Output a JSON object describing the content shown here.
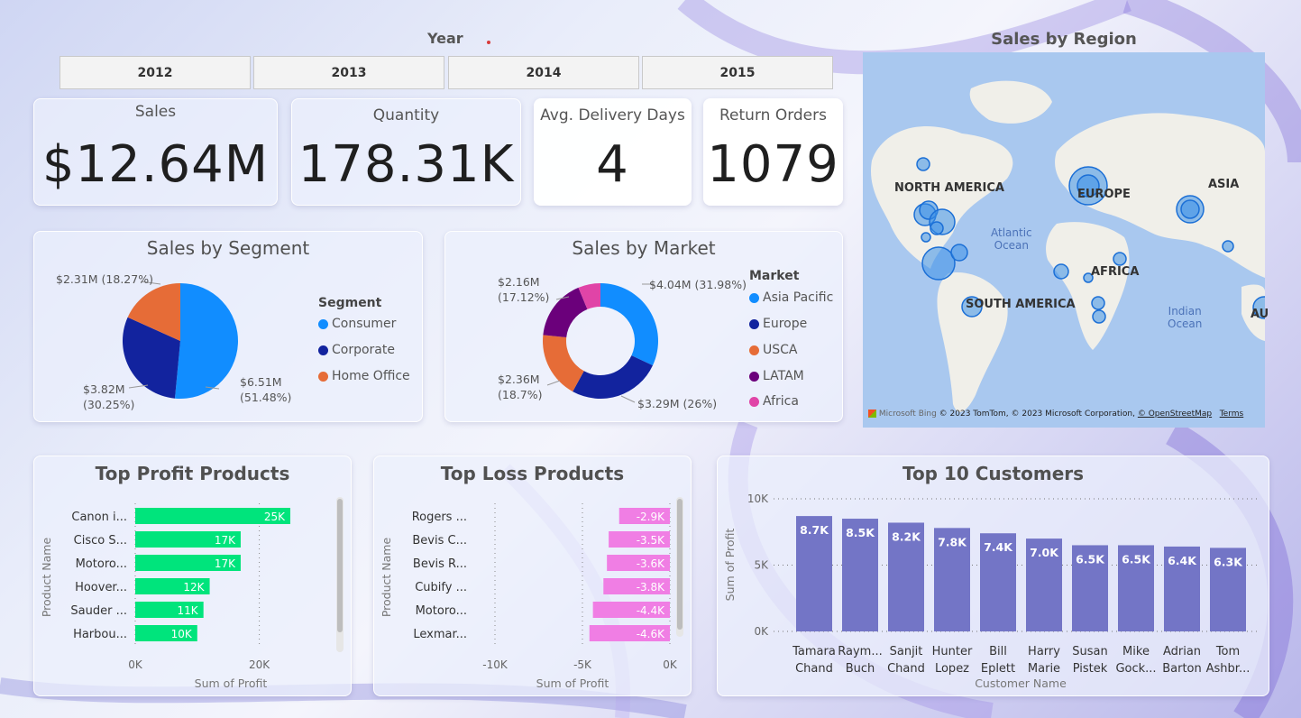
{
  "year_filter": {
    "title": "Year",
    "options": [
      "2012",
      "2013",
      "2014",
      "2015"
    ]
  },
  "kpis": {
    "sales": {
      "label": "Sales",
      "value": "$12.64M"
    },
    "quantity": {
      "label": "Quantity",
      "value": "178.31K"
    },
    "delivery": {
      "label": "Avg. Delivery Days",
      "value": "4"
    },
    "returns": {
      "label": "Return Orders",
      "value": "1079"
    }
  },
  "segment": {
    "title": "Sales by Segment",
    "legend_title": "Segment",
    "legend": [
      "Consumer",
      "Corporate",
      "Home Office"
    ],
    "labels": {
      "consumer_a": "$6.51M",
      "consumer_b": "(51.48%)",
      "corporate_a": "$3.82M",
      "corporate_b": "(30.25%)",
      "home": "$2.31M (18.27%)"
    }
  },
  "market": {
    "title": "Sales by Market",
    "legend_title": "Market",
    "legend": [
      "Asia Pacific",
      "Europe",
      "USCA",
      "LATAM",
      "Africa"
    ],
    "labels": {
      "asia": "$4.04M (31.98%)",
      "europe": "$3.29M (26%)",
      "usca_a": "$2.36M",
      "usca_b": "(18.7%)",
      "latam_a": "$2.16M",
      "latam_b": "(17.12%)"
    }
  },
  "map": {
    "title": "Sales by Region",
    "regions": [
      "NORTH AMERICA",
      "EUROPE",
      "ASIA",
      "AFRICA",
      "SOUTH AMERICA",
      "AU"
    ],
    "oceans": {
      "atlantic_1": "Atlantic",
      "atlantic_2": "Ocean",
      "indian_1": "Indian",
      "indian_2": "Ocean"
    },
    "footer_brand": "Microsoft Bing",
    "footer_text": "© 2023 TomTom, © 2023 Microsoft Corporation,",
    "footer_link": "© OpenStreetMap",
    "footer_terms": "Terms"
  },
  "colors": {
    "consumer": "#118dff",
    "corporate": "#12239e",
    "home_office": "#e66c37",
    "latam": "#6b007b",
    "africa": "#e044a7",
    "profit_bar": "#00e47c",
    "loss_bar": "#f07ee4",
    "customer_bar": "#7375c6"
  },
  "chart_data": [
    {
      "type": "pie",
      "title": "Sales by Segment",
      "categories": [
        "Consumer",
        "Corporate",
        "Home Office"
      ],
      "values": [
        6.51,
        3.82,
        2.31
      ],
      "percent": [
        51.48,
        30.25,
        18.27
      ],
      "unit": "$M"
    },
    {
      "type": "pie",
      "title": "Sales by Market",
      "categories": [
        "Asia Pacific",
        "Europe",
        "USCA",
        "LATAM",
        "Africa"
      ],
      "values": [
        4.04,
        3.29,
        2.36,
        2.16,
        0.79
      ],
      "percent": [
        31.98,
        26,
        18.7,
        17.12,
        6.2
      ],
      "unit": "$M"
    },
    {
      "type": "bar",
      "title": "Top Profit Products",
      "orientation": "horizontal",
      "categories": [
        "Canon i...",
        "Cisco S...",
        "Motoro...",
        "Hoover...",
        "Sauder ...",
        "Harbou..."
      ],
      "values": [
        25000,
        17000,
        17000,
        12000,
        11000,
        10000
      ],
      "data_labels": [
        "25K",
        "17K",
        "17K",
        "12K",
        "11K",
        "10K"
      ],
      "xlabel": "Sum of Profit",
      "ylabel": "Product Name",
      "xticks": [
        "0K",
        "20K"
      ],
      "xlim": [
        0,
        25000
      ]
    },
    {
      "type": "bar",
      "title": "Top Loss Products",
      "orientation": "horizontal",
      "categories": [
        "Rogers ...",
        "Bevis C...",
        "Bevis R...",
        "Cubify ...",
        "Motoro...",
        "Lexmar..."
      ],
      "values": [
        -2900,
        -3500,
        -3600,
        -3800,
        -4400,
        -4600
      ],
      "data_labels": [
        "-2.9K",
        "-3.5K",
        "-3.6K",
        "-3.8K",
        "-4.4K",
        "-4.6K"
      ],
      "xlabel": "Sum of Profit",
      "ylabel": "Product Name",
      "xticks": [
        "-10K",
        "-5K",
        "0K"
      ],
      "xlim": [
        -10000,
        0
      ]
    },
    {
      "type": "bar",
      "title": "Top 10 Customers",
      "categories": [
        [
          "Tamara",
          "Chand"
        ],
        [
          "Raym...",
          "Buch"
        ],
        [
          "Sanjit",
          "Chand"
        ],
        [
          "Hunter",
          "Lopez"
        ],
        [
          "Bill",
          "Eplett"
        ],
        [
          "Harry",
          "Marie"
        ],
        [
          "Susan",
          "Pistek"
        ],
        [
          "Mike",
          "Gock..."
        ],
        [
          "Adrian",
          "Barton"
        ],
        [
          "Tom",
          "Ashbr..."
        ]
      ],
      "values": [
        8700,
        8500,
        8200,
        7800,
        7400,
        7000,
        6500,
        6500,
        6400,
        6300
      ],
      "data_labels": [
        "8.7K",
        "8.5K",
        "8.2K",
        "7.8K",
        "7.4K",
        "7.0K",
        "6.5K",
        "6.5K",
        "6.4K",
        "6.3K"
      ],
      "xlabel": "Customer Name",
      "ylabel": "Sum of Profit",
      "yticks": [
        "0K",
        "5K",
        "10K"
      ],
      "ylim": [
        0,
        10000
      ]
    }
  ]
}
